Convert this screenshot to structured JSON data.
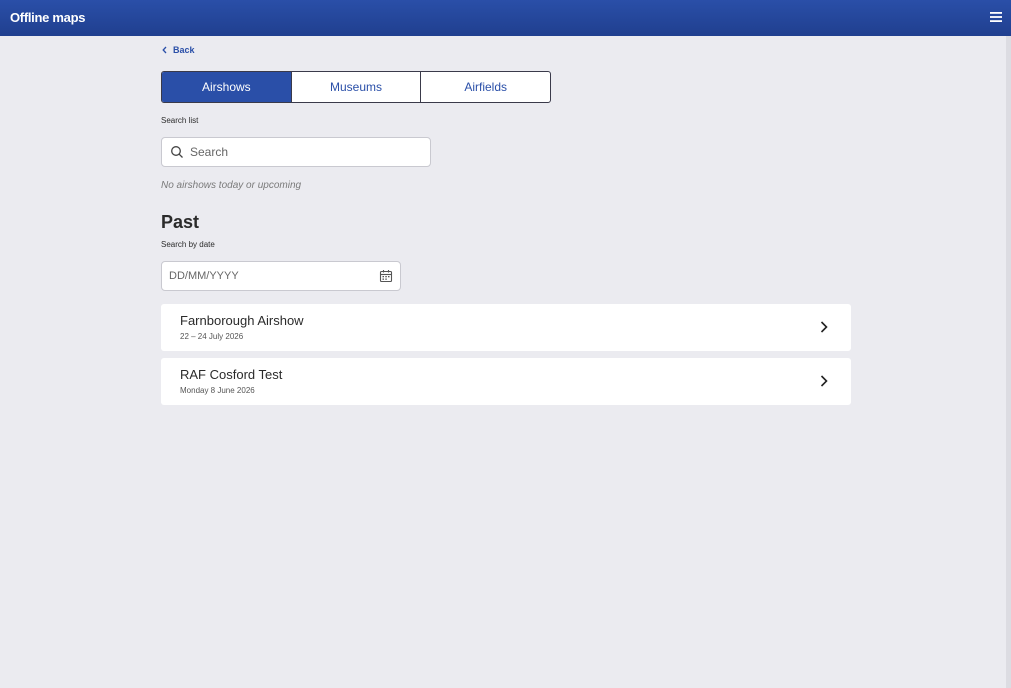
{
  "app": {
    "title": "Offline maps"
  },
  "nav": {
    "back_label": "Back"
  },
  "tabs": [
    {
      "label": "Airshows",
      "active": true
    },
    {
      "label": "Museums",
      "active": false
    },
    {
      "label": "Airfields",
      "active": false
    }
  ],
  "search": {
    "label": "Search list",
    "placeholder": "Search",
    "value": ""
  },
  "upcoming": {
    "empty_message": "No airshows today or upcoming"
  },
  "past": {
    "title": "Past",
    "date_label": "Search by date",
    "date_placeholder": "DD/MM/YYYY",
    "items": [
      {
        "title": "Farnborough Airshow",
        "date": "22 – 24 July 2026"
      },
      {
        "title": "RAF Cosford Test",
        "date": "Monday 8 June 2026"
      }
    ]
  },
  "colors": {
    "brand": "#2a4fa8",
    "background": "#ebebf0",
    "card": "#ffffff"
  },
  "icons": {
    "menu": "hamburger-menu-icon",
    "back": "chevron-left-icon",
    "search": "search-icon",
    "calendar": "calendar-icon",
    "row": "chevron-right-icon"
  }
}
